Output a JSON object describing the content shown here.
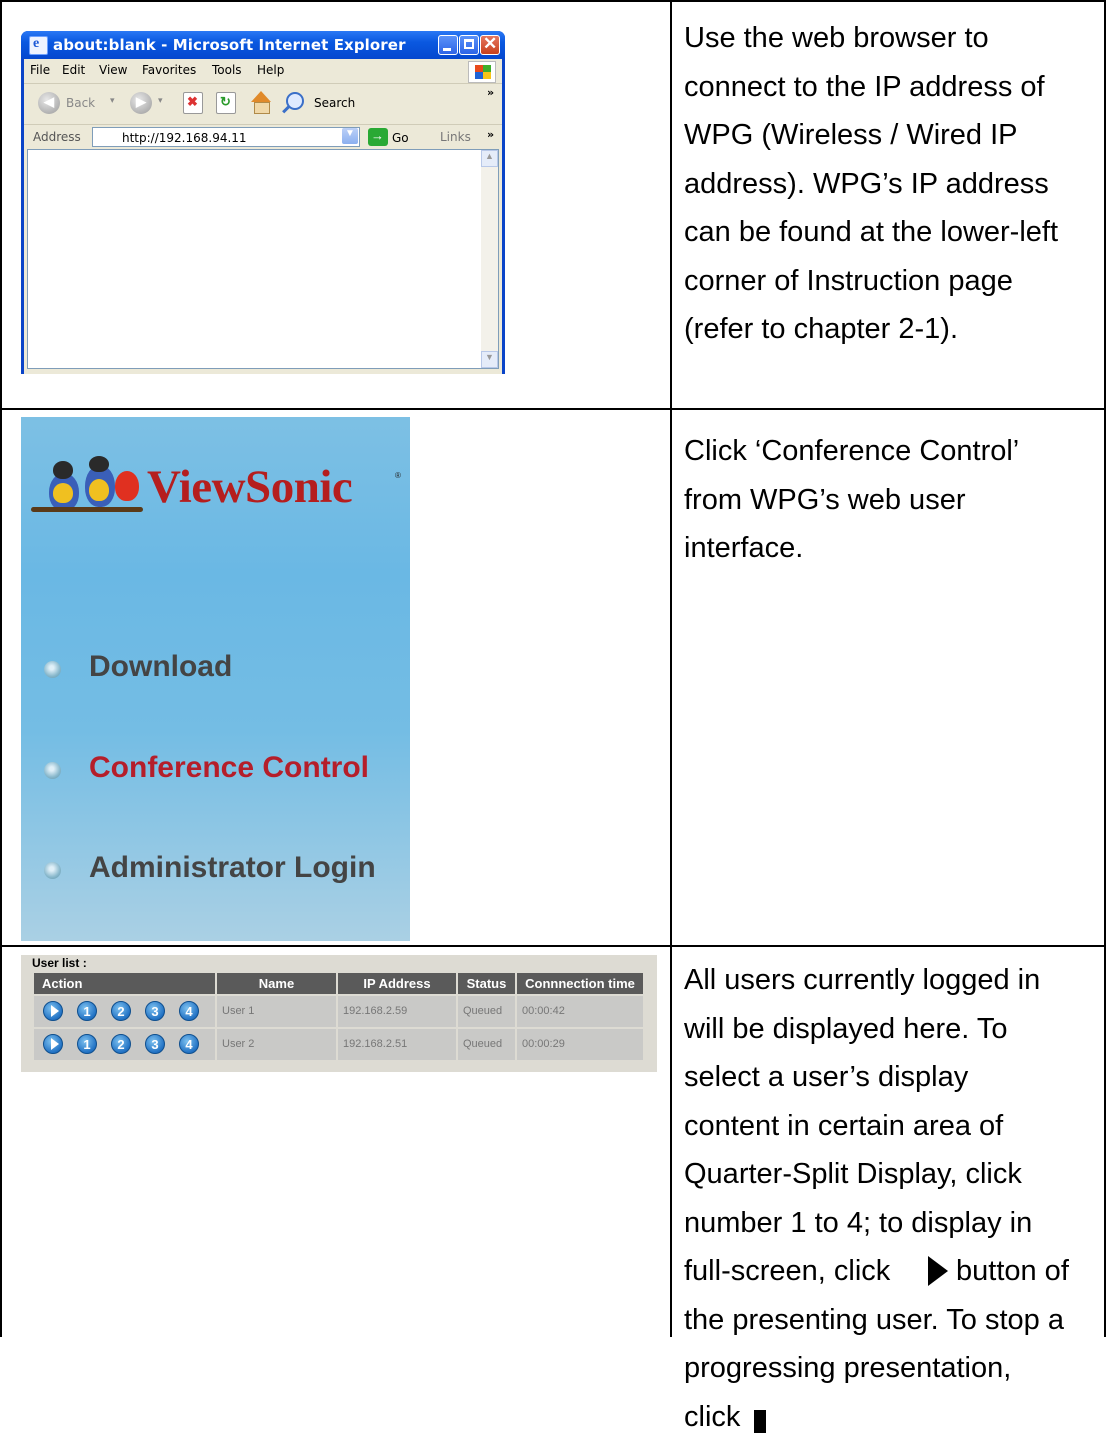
{
  "ie": {
    "title": "about:blank - Microsoft Internet Explorer",
    "menu": [
      "File",
      "Edit",
      "View",
      "Favorites",
      "Tools",
      "Help"
    ],
    "back_label": "Back",
    "search_label": "Search",
    "address_label": "Address",
    "address_value": "http://192.168.94.11",
    "go_label": "Go",
    "links_label": "Links"
  },
  "viewsonic": {
    "logo_text": "ViewSonic",
    "menu": [
      {
        "label": "Download",
        "color": "#444444"
      },
      {
        "label": "Conference Control",
        "color": "#b51e2a"
      },
      {
        "label": "Administrator Login",
        "color": "#444444"
      }
    ]
  },
  "user_list": {
    "title": "User list  :",
    "headers": [
      "Action",
      "Name",
      "IP Address",
      "Status",
      "Connnection time"
    ],
    "action_buttons": [
      "1",
      "2",
      "3",
      "4"
    ],
    "rows": [
      {
        "name": "User 1",
        "ip": "192.168.2.59",
        "status": "Queued",
        "time": "00:00:42"
      },
      {
        "name": "User 2",
        "ip": "192.168.2.51",
        "status": "Queued",
        "time": "00:00:29"
      }
    ]
  },
  "descriptions": {
    "row1": [
      "Use the web browser to",
      "connect to the IP address of",
      "WPG (Wireless / Wired IP",
      "address). WPG’s IP address",
      "can be found at the lower-left",
      "corner of Instruction page",
      "(refer to chapter 2-1)."
    ],
    "row2": [
      "Click ‘Conference Control’",
      "from WPG’s web user",
      "interface."
    ],
    "row3": [
      "All users currently logged in",
      "will be displayed here. To",
      "select a user’s display",
      "content in certain area of",
      "Quarter-Split Display, click",
      "number 1 to 4; to display in"
    ],
    "row3_play_before": "full-screen, click",
    "row3_play_after": "button of",
    "row3_tail": [
      "the presenting user. To stop a",
      "progressing presentation,"
    ],
    "row3_click": "click"
  },
  "colors": {
    "ie_title": "#0a58e0",
    "logo_red": "#b51e1e",
    "panel_blue": "#6ab8e4",
    "table_header": "#5a5a5a"
  }
}
